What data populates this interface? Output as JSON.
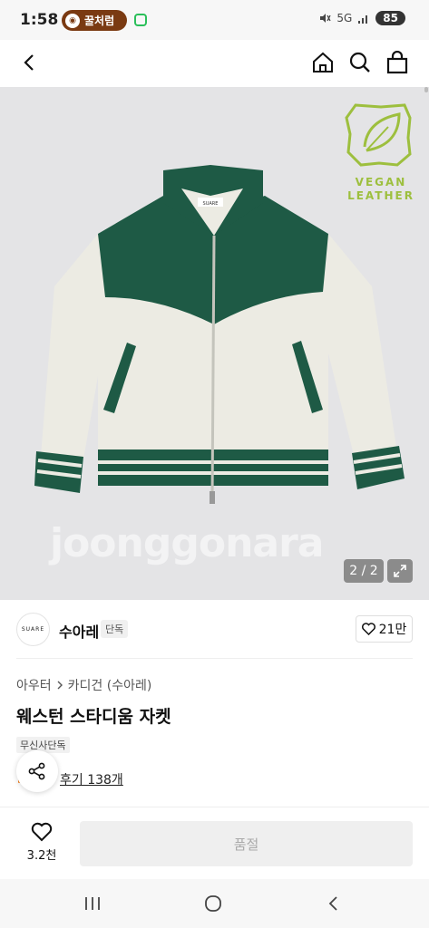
{
  "status_bar": {
    "time": "1:58",
    "app_pill_label": "꿀처럼",
    "network": "5G",
    "battery": "85"
  },
  "header": {
    "icons": [
      "back-icon",
      "home-icon",
      "search-icon",
      "cart-icon"
    ]
  },
  "product_image": {
    "badge_top": "VEGAN",
    "badge_bottom": "LEATHER",
    "jacket_label": "SUARE",
    "watermark": "joonggonara",
    "counter": "2 / 2",
    "colors": {
      "background": "#e4e4e6",
      "body": "#ecebe3",
      "green": "#1e5a45",
      "badge": "#9dbf3e"
    }
  },
  "brand": {
    "logo_text": "SUARE",
    "name": "수아레",
    "badge": "단독",
    "like_count": "21만"
  },
  "product": {
    "breadcrumb_1": "아우터",
    "breadcrumb_2": "카디건 (수아레)",
    "title": "웨스턴 스타디움 자켓",
    "exclusive_tag": "무신사단독",
    "review_link": "후기 138개"
  },
  "bottom_bar": {
    "like_count": "3.2천",
    "soldout_label": "품절"
  },
  "system_nav": {
    "icons": [
      "recent-apps-icon",
      "home-button-icon",
      "back-nav-icon"
    ]
  }
}
